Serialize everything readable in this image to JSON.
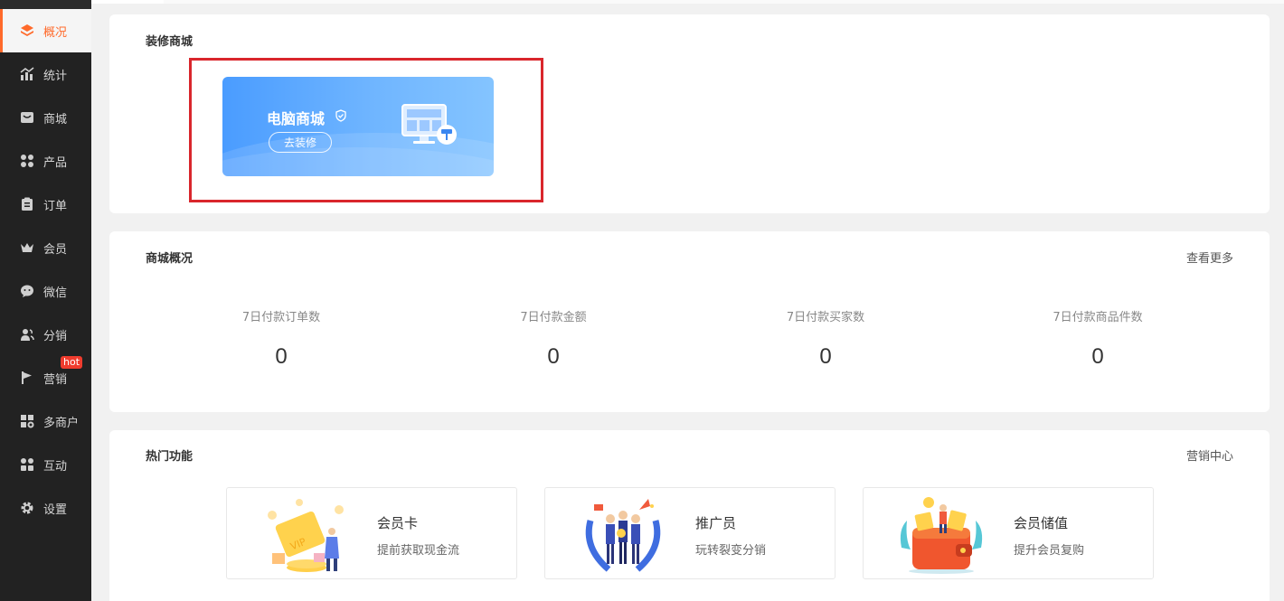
{
  "sidebar": {
    "items": [
      {
        "label": "概况",
        "icon": "layers-icon",
        "active": true
      },
      {
        "label": "统计",
        "icon": "chart-icon"
      },
      {
        "label": "商城",
        "icon": "store-icon"
      },
      {
        "label": "产品",
        "icon": "grid-icon"
      },
      {
        "label": "订单",
        "icon": "clipboard-icon"
      },
      {
        "label": "会员",
        "icon": "crown-icon"
      },
      {
        "label": "微信",
        "icon": "wechat-icon"
      },
      {
        "label": "分销",
        "icon": "users-icon"
      },
      {
        "label": "营销",
        "icon": "flag-icon",
        "badge": "hot"
      },
      {
        "label": "多商户",
        "icon": "merchant-icon"
      },
      {
        "label": "互动",
        "icon": "interact-icon"
      },
      {
        "label": "设置",
        "icon": "gear-icon"
      }
    ]
  },
  "decorate": {
    "title": "装修商城",
    "banner_title": "电脑商城",
    "button": "去装修"
  },
  "overview": {
    "title": "商城概况",
    "more": "查看更多",
    "stats": [
      {
        "label": "7日付款订单数",
        "value": "0"
      },
      {
        "label": "7日付款金额",
        "value": "0"
      },
      {
        "label": "7日付款买家数",
        "value": "0"
      },
      {
        "label": "7日付款商品件数",
        "value": "0"
      }
    ]
  },
  "hot": {
    "title": "热门功能",
    "more": "营销中心",
    "features": [
      {
        "name": "会员卡",
        "desc": "提前获取现金流",
        "icon": "vip-card-icon"
      },
      {
        "name": "推广员",
        "desc": "玩转裂变分销",
        "icon": "promoter-icon"
      },
      {
        "name": "会员储值",
        "desc": "提升会员复购",
        "icon": "wallet-icon"
      }
    ]
  },
  "colors": {
    "accent": "#ff6a2b",
    "sidebar_bg": "#222222",
    "banner_blue": "#4a9cff",
    "highlight_red": "#d9262c",
    "hot_badge": "#f03c2e"
  }
}
